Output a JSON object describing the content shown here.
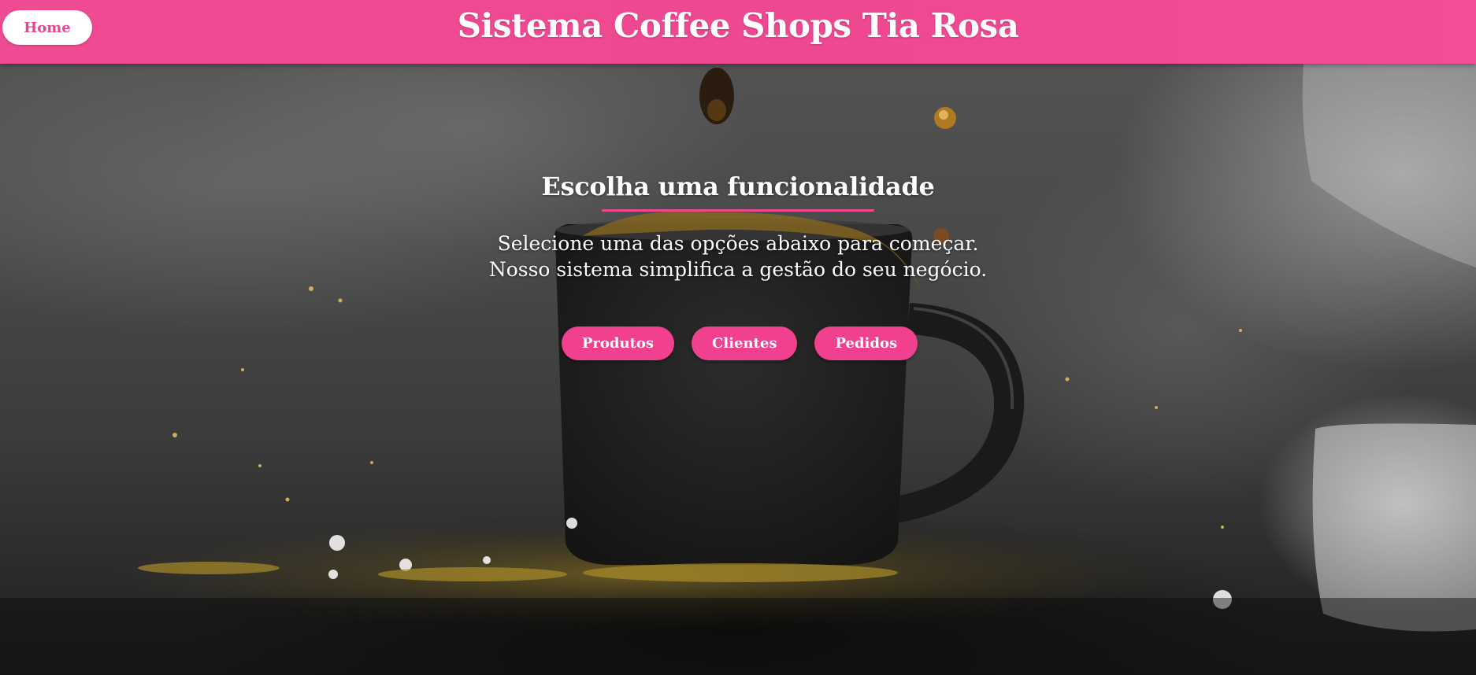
{
  "header": {
    "home_label": "Home",
    "title": "Sistema Coffee Shops Tia Rosa"
  },
  "main": {
    "heading": "Escolha uma funcionalidade",
    "description_line1": "Selecione uma das opções abaixo para começar.",
    "description_line2": "Nosso sistema simplifica a gestão do seu negócio.",
    "buttons": [
      {
        "label": "Produtos"
      },
      {
        "label": "Clientes"
      },
      {
        "label": "Pedidos"
      }
    ]
  },
  "colors": {
    "accent": "#ee4890",
    "button_pink": "#f0408e",
    "text_light": "#ffffff"
  }
}
